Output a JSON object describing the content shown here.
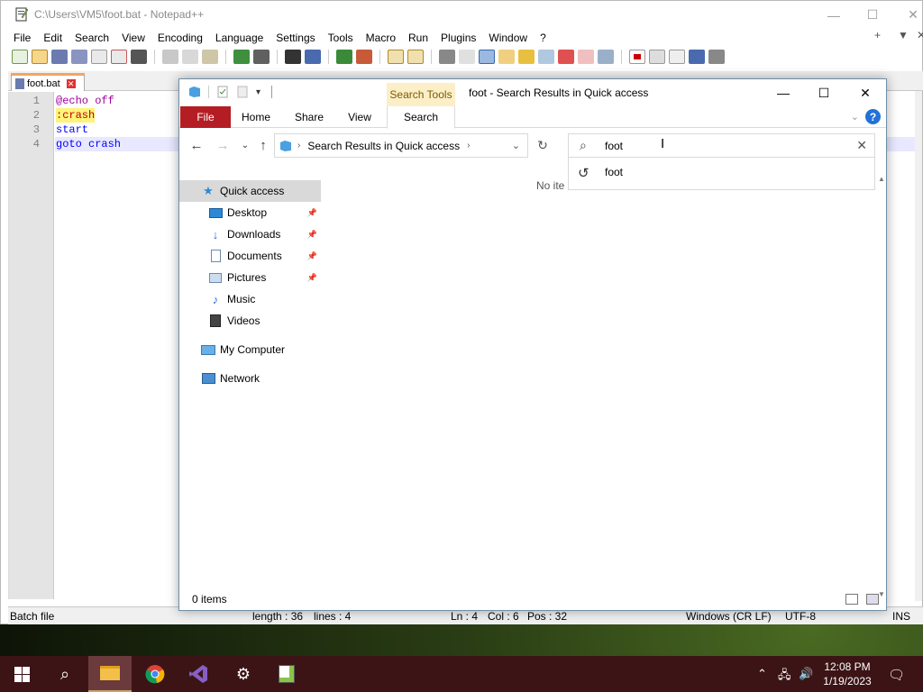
{
  "notepad": {
    "title": "C:\\Users\\VM5\\foot.bat - Notepad++",
    "menu": [
      "File",
      "Edit",
      "Search",
      "View",
      "Encoding",
      "Language",
      "Settings",
      "Tools",
      "Macro",
      "Run",
      "Plugins",
      "Window",
      "?"
    ],
    "menu_right": [
      "+",
      "▼",
      "✕"
    ],
    "tab_label": "foot.bat",
    "lines": [
      {
        "num": "1",
        "text": "@echo off"
      },
      {
        "num": "2",
        "text": ":crash"
      },
      {
        "num": "3",
        "text": "start"
      },
      {
        "num": "4",
        "text": "goto crash"
      }
    ],
    "status": {
      "type": "Batch file",
      "length": "length : 36",
      "lines": "lines : 4",
      "ln": "Ln : 4",
      "col": "Col : 6",
      "pos": "Pos : 32",
      "eol": "Windows (CR LF)",
      "encoding": "UTF-8",
      "mode": "INS"
    }
  },
  "explorer": {
    "title": "foot - Search Results in Quick access",
    "contextual_tab": "Search Tools",
    "ribbon_tabs": [
      "File",
      "Home",
      "Share",
      "View",
      "Search"
    ],
    "help": "?",
    "address": "Search Results in Quick access",
    "search_value": "foot",
    "suggestion": "foot",
    "nav": [
      {
        "label": "Quick access",
        "icon": "star-icon",
        "pinned": false
      },
      {
        "label": "Desktop",
        "icon": "desktop-icon",
        "pinned": true
      },
      {
        "label": "Downloads",
        "icon": "download-icon",
        "pinned": true
      },
      {
        "label": "Documents",
        "icon": "document-icon",
        "pinned": true
      },
      {
        "label": "Pictures",
        "icon": "pictures-icon",
        "pinned": true
      },
      {
        "label": "Music",
        "icon": "music-icon",
        "pinned": false
      },
      {
        "label": "Videos",
        "icon": "videos-icon",
        "pinned": false
      },
      {
        "label": "My Computer",
        "icon": "computer-icon",
        "pinned": false
      },
      {
        "label": "Network",
        "icon": "network-icon",
        "pinned": false
      }
    ],
    "empty_message": "No ite",
    "status_count": "0 items"
  },
  "taskbar": {
    "time": "12:08 PM",
    "date": "1/19/2023",
    "apps": [
      "start-icon",
      "search-icon",
      "file-explorer-icon",
      "chrome-icon",
      "visual-studio-icon",
      "settings-icon",
      "notepadpp-icon"
    ]
  },
  "colors": {
    "file_tab": "#b51d24",
    "search_tools": "#fcefc8",
    "taskbar": "#3c1416",
    "selection": "#d9d9d9"
  }
}
